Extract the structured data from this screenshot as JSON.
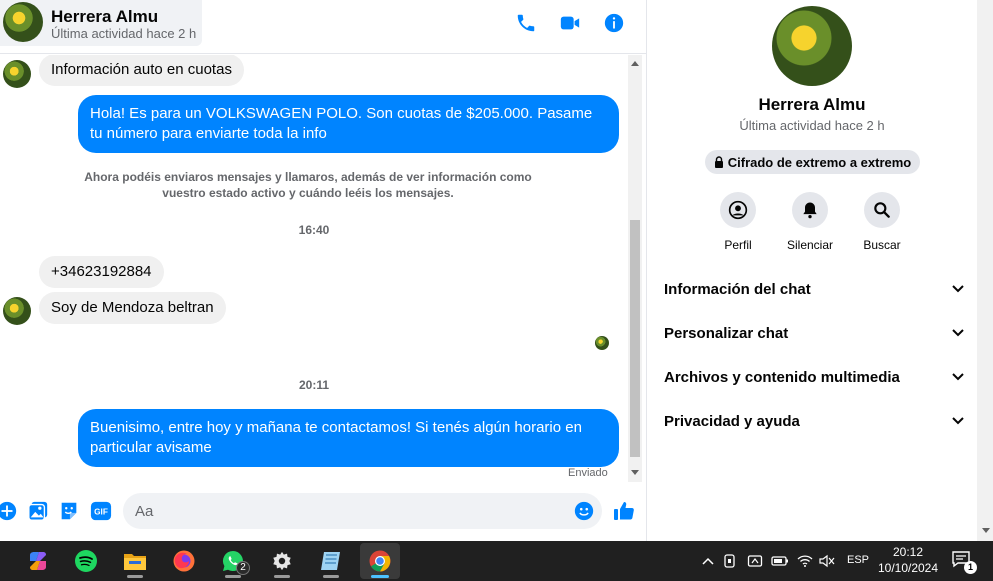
{
  "contact": {
    "name": "Herrera Almu",
    "last_active": "Última actividad hace 2 h"
  },
  "messages": {
    "received_1": "Información auto en cuotas",
    "sent_1": "Hola! Es para un VOLKSWAGEN POLO. Son cuotas de $205.000. Pasame tu número para enviarte toda la info",
    "system_note": "Ahora podéis enviaros mensajes y llamaros, además de ver información como vuestro estado activo y cuándo leéis los mensajes.",
    "time_1": "16:40",
    "received_2": "+34623192884",
    "received_3": "Soy de Mendoza beltran",
    "time_2": "20:11",
    "sent_2": "Buenisimo, entre hoy y mañana te contactamos! Si tenés algún horario en particular avisame",
    "sent_status": "Enviado"
  },
  "composer": {
    "placeholder": "Aa"
  },
  "info_panel": {
    "encryption": "Cifrado de extremo a extremo",
    "actions": [
      "Perfil",
      "Silenciar",
      "Buscar"
    ],
    "sections": [
      "Información del chat",
      "Personalizar chat",
      "Archivos y contenido multimedia",
      "Privacidad y ayuda"
    ]
  },
  "taskbar": {
    "whatsapp_badge": "2",
    "language": "ESP",
    "time": "20:12",
    "date": "10/10/2024",
    "notifications": "1"
  },
  "colors": {
    "accent": "#0084ff",
    "bubble_in": "#f0f0f0",
    "taskbar": "#202020"
  },
  "icons": {
    "header": [
      "phone-icon",
      "video-camera-icon",
      "info-icon"
    ],
    "composer": [
      "plus-icon",
      "image-icon",
      "sticker-icon",
      "gif-icon",
      "emoji-icon",
      "thumbs-up-icon"
    ]
  }
}
